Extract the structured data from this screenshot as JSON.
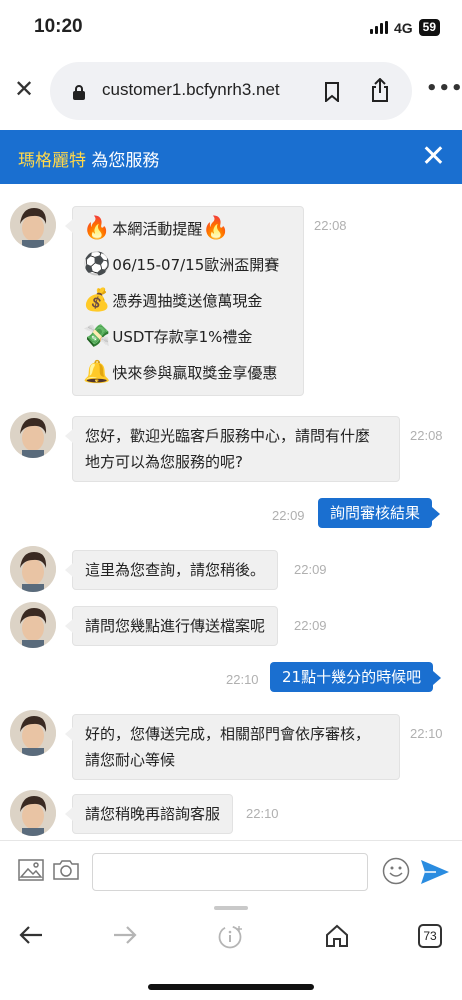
{
  "status": {
    "time": "10:20",
    "network": "4G",
    "battery": "59"
  },
  "browser": {
    "url": "customer1.bcfynrh3.net",
    "tab_count": "73"
  },
  "chat": {
    "agent_name": "瑪格麗特",
    "title_suffix": " 為您服務"
  },
  "messages": {
    "promo": {
      "lines": [
        {
          "emoji": "🔥",
          "text": "本網活動提醒",
          "emoji_after": "🔥"
        },
        {
          "emoji": "⚽",
          "text": "06/15-07/15歐洲盃開賽"
        },
        {
          "emoji": "💰",
          "text": "憑券週抽獎送億萬現金"
        },
        {
          "emoji": "💸",
          "text": "USDT存款享1%禮金"
        },
        {
          "emoji": "🔔",
          "text": "快來參與贏取獎金享優惠"
        }
      ],
      "time": "22:08"
    },
    "welcome": {
      "line1": "您好，歡迎光臨客戶服務中心，請問有什麼",
      "line2": "地方可以為您服務的呢?",
      "time": "22:08"
    },
    "user1": {
      "text": "詢問審核結果",
      "time": "22:09"
    },
    "reply1": {
      "text": "這里為您查詢，請您稍後。",
      "time": "22:09"
    },
    "reply2": {
      "text": "請問您幾點進行傳送檔案呢",
      "time": "22:09"
    },
    "user2": {
      "text": "21點十幾分的時候吧",
      "time": "22:10"
    },
    "reply3": {
      "line1": "好的，您傳送完成，相關部門會依序審核，",
      "line2": "請您耐心等候",
      "time": "22:10"
    },
    "reply4": {
      "text": "請您稍晚再諮詢客服",
      "time": "22:10"
    }
  },
  "colors": {
    "accent": "#1a6fd0",
    "agent_name": "#ffd84a"
  }
}
